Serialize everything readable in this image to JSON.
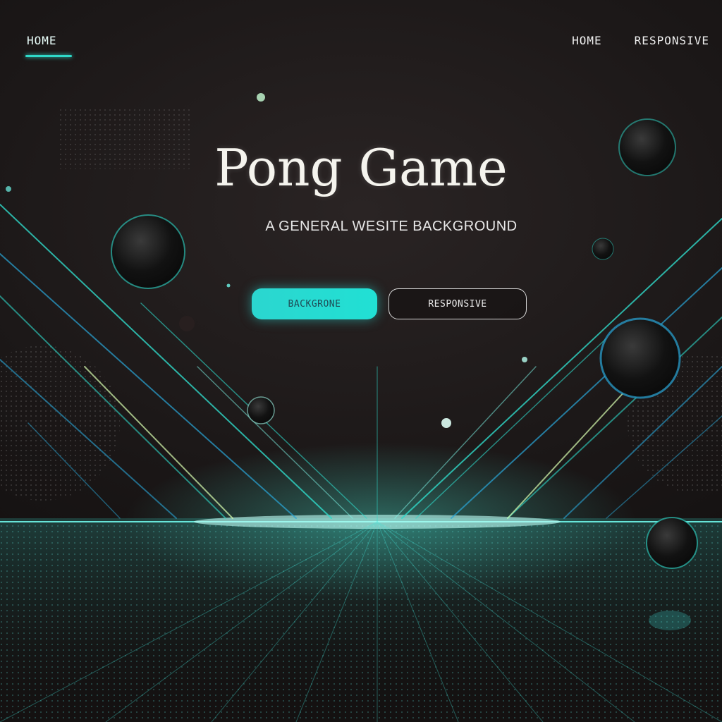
{
  "nav": {
    "left_home": "HOME",
    "right_links": [
      "HOME",
      "RESPONSIVE"
    ]
  },
  "hero": {
    "title": "Pong Game",
    "subtitle": "A GENERAL WESITE BACKGROUND"
  },
  "buttons": {
    "primary_label": "BACKGRONE",
    "secondary_label": "RESPONSIVE"
  },
  "colors": {
    "accent": "#2fd9c9",
    "background": "#1b1717",
    "text": "#f5f4ee"
  }
}
